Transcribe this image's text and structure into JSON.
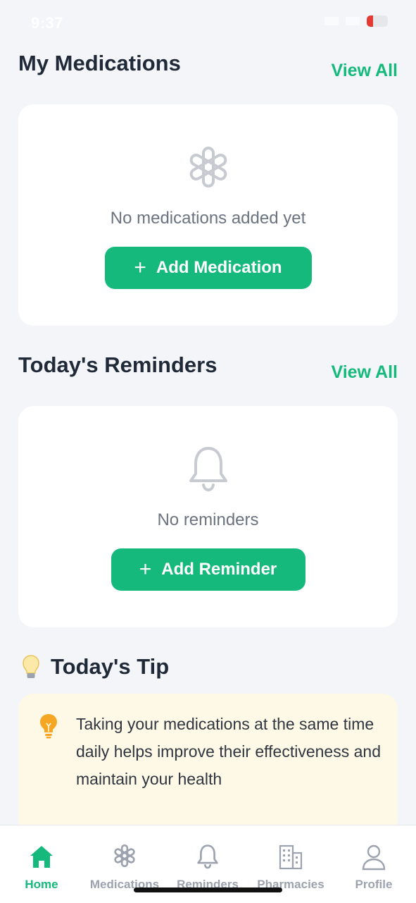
{
  "status_bar": {
    "time": "9:37",
    "battery_color": "#E53935"
  },
  "colors": {
    "accent": "#16B97C",
    "tip_bg": "#FEF9E6",
    "page_bg": "#F3F5F8"
  },
  "medications": {
    "title": "My Medications",
    "view_all": "View All",
    "empty_icon": "medication-asterisk-icon",
    "empty_text": "No medications added yet",
    "add_button": "Add Medication"
  },
  "reminders": {
    "title": "Today's Reminders",
    "view_all": "View All",
    "empty_icon": "bell-icon",
    "empty_text": "No reminders",
    "add_button": "Add Reminder"
  },
  "tip": {
    "title": "Today's Tip",
    "icon": "lightbulb-icon",
    "text": "Taking your medications at the same time daily helps improve their effectiveness and maintain your health"
  },
  "tabs": [
    {
      "label": "Home",
      "icon": "home-icon",
      "active": true
    },
    {
      "label": "Medications",
      "icon": "medication-icon",
      "active": false
    },
    {
      "label": "Reminders",
      "icon": "bell-icon",
      "active": false
    },
    {
      "label": "Pharmacies",
      "icon": "building-icon",
      "active": false
    },
    {
      "label": "Profile",
      "icon": "person-icon",
      "active": false
    }
  ]
}
